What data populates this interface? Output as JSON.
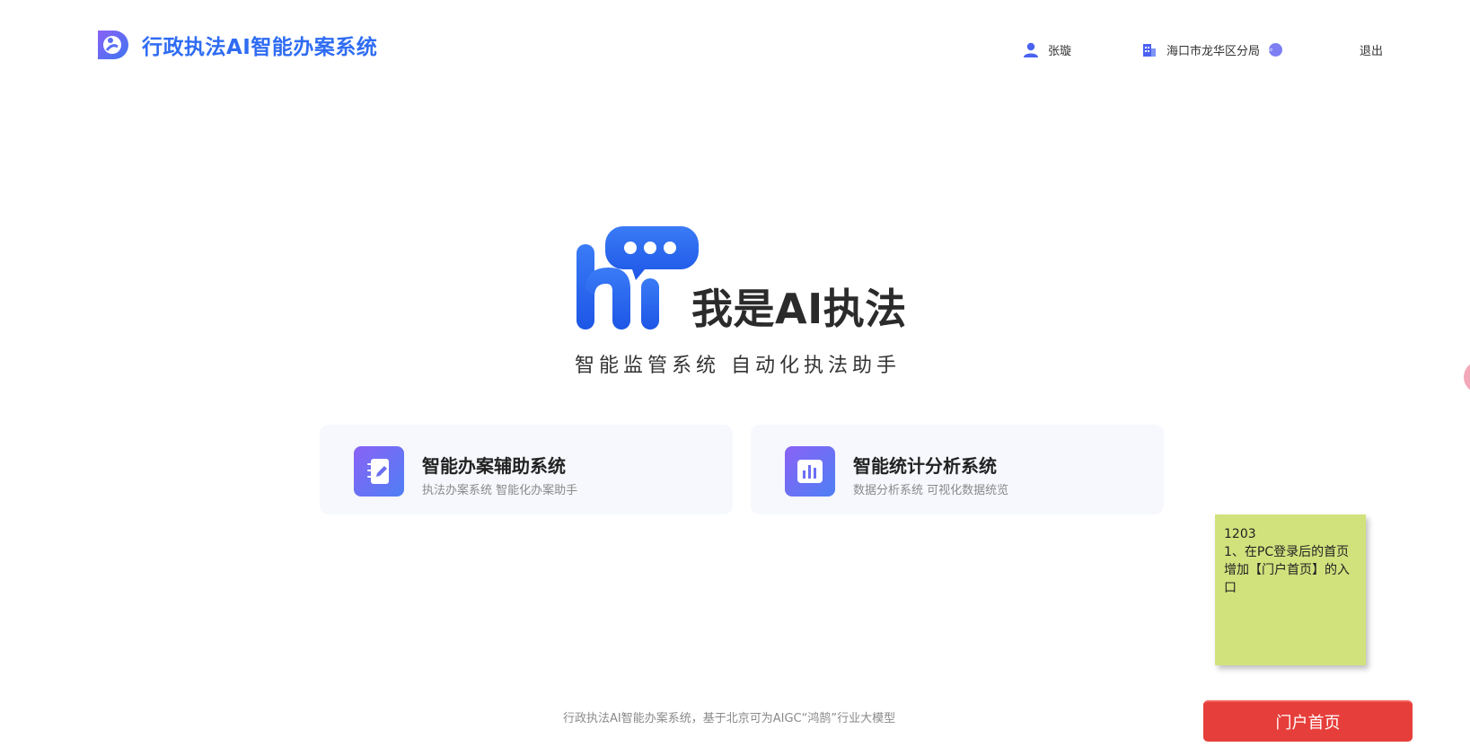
{
  "header": {
    "app_title": "行政执法AI智能办案系统",
    "user_name": "张璇",
    "org_name": "海口市龙华区分局",
    "logout_label": "退出"
  },
  "hero": {
    "title": "我是AI执法",
    "subtitle": "智能监管系统 自动化执法助手"
  },
  "cards": [
    {
      "title": "智能办案辅助系统",
      "desc": "执法办案系统 智能化办案助手",
      "icon": "notebook-pen-icon"
    },
    {
      "title": "智能统计分析系统",
      "desc": "数据分析系统 可视化数据统览",
      "icon": "bar-chart-icon"
    }
  ],
  "sticky_note": {
    "line1": "1203",
    "line2": "1、在PC登录后的首页增加【门户首页】的入口"
  },
  "footer": {
    "text": "行政执法AI智能办案系统，基于北京可为AIGC“鸿鹄”行业大模型"
  },
  "portal_button": {
    "label": "门户首页"
  },
  "colors": {
    "brand_blue": "#2f6cf3",
    "card_bg": "#f6f8fd",
    "sticky_bg": "#d1e27d",
    "portal_red": "#e63e3a"
  }
}
